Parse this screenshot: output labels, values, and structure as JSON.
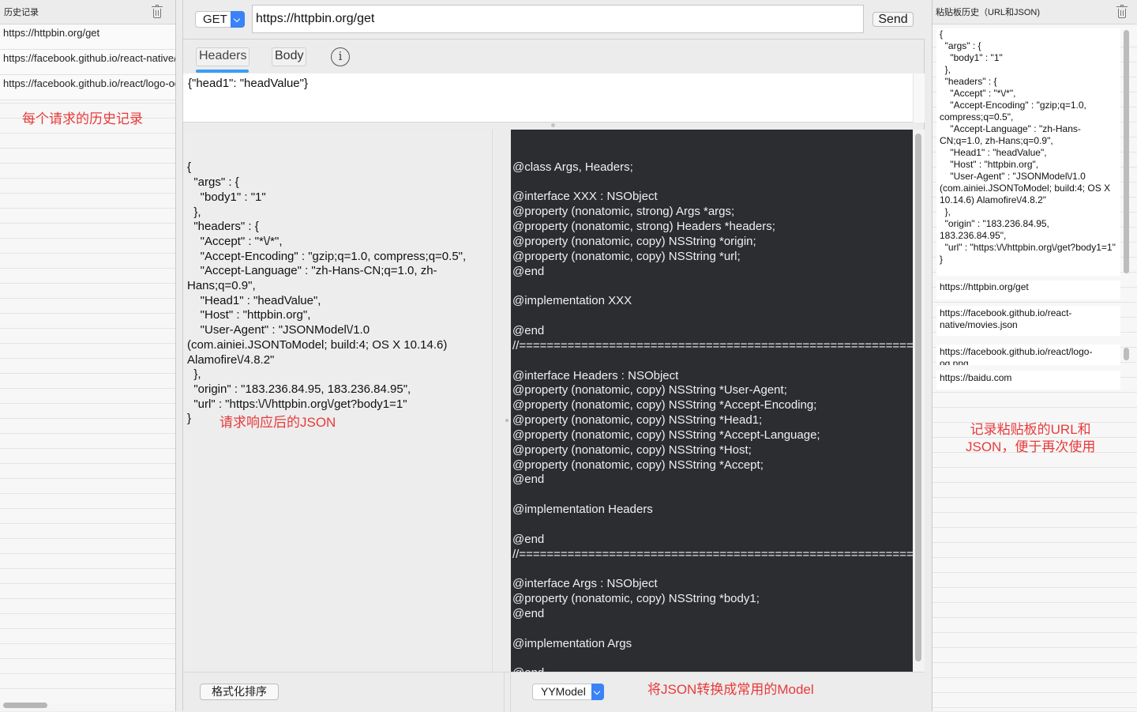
{
  "history": {
    "title": "历史记录",
    "items": [
      "https://httpbin.org/get",
      "https://facebook.github.io/react-native/movies.json",
      "https://facebook.github.io/react/logo-og.png"
    ],
    "annotation": "每个请求的历史记录"
  },
  "request": {
    "method": "GET",
    "url": "https://httpbin.org/get",
    "send_label": "Send",
    "tabs": [
      "Headers",
      "Body"
    ],
    "info_glyph": "i",
    "headers_value": "{\"head1\": \"headValue\"}"
  },
  "response": {
    "json": "{\n  \"args\" : {\n    \"body1\" : \"1\"\n  },\n  \"headers\" : {\n    \"Accept\" : \"*\\/*\",\n    \"Accept-Encoding\" : \"gzip;q=1.0, compress;q=0.5\",\n    \"Accept-Language\" : \"zh-Hans-CN;q=1.0, zh-Hans;q=0.9\",\n    \"Head1\" : \"headValue\",\n    \"Host\" : \"httpbin.org\",\n    \"User-Agent\" : \"JSONModel\\/1.0 (com.ainiei.JSONToModel; build:4; OS X 10.14.6) Alamofire\\/4.8.2\"\n  },\n  \"origin\" : \"183.236.84.95, 183.236.84.95\",\n  \"url\" : \"https:\\/\\/httpbin.org\\/get?body1=1\"\n}",
    "annotation": "请求响应后的JSON",
    "format_button": "格式化排序"
  },
  "model": {
    "code": "@class Args, Headers;\n\n@interface XXX : NSObject\n@property (nonatomic, strong) Args *args;\n@property (nonatomic, strong) Headers *headers;\n@property (nonatomic, copy) NSString *origin;\n@property (nonatomic, copy) NSString *url;\n@end\n\n@implementation XXX\n\n@end\n//=================================================================\n\n@interface Headers : NSObject\n@property (nonatomic, copy) NSString *User-Agent;\n@property (nonatomic, copy) NSString *Accept-Encoding;\n@property (nonatomic, copy) NSString *Head1;\n@property (nonatomic, copy) NSString *Accept-Language;\n@property (nonatomic, copy) NSString *Host;\n@property (nonatomic, copy) NSString *Accept;\n@end\n\n@implementation Headers\n\n@end\n//=================================================================\n\n@interface Args : NSObject\n@property (nonatomic, copy) NSString *body1;\n@end\n\n@implementation Args\n\n@end\n//=================================================================",
    "selected": "YYModel",
    "annotation": "将JSON转换成常用的Model"
  },
  "clipboard": {
    "title": "粘贴板历史（URL和JSON)",
    "json_item": "{\n  \"args\" : {\n    \"body1\" : \"1\"\n  },\n  \"headers\" : {\n    \"Accept\" : \"*\\/*\",\n    \"Accept-Encoding\" : \"gzip;q=1.0, compress;q=0.5\",\n    \"Accept-Language\" : \"zh-Hans-CN;q=1.0, zh-Hans;q=0.9\",\n    \"Head1\" : \"headValue\",\n    \"Host\" : \"httpbin.org\",\n    \"User-Agent\" : \"JSONModel\\/1.0 (com.ainiei.JSONToModel; build:4; OS X 10.14.6) Alamofire\\/4.8.2\"\n  },\n  \"origin\" : \"183.236.84.95, 183.236.84.95\",\n  \"url\" : \"https:\\/\\/httpbin.org\\/get?body1=1\"\n}",
    "items": [
      "https://httpbin.org/get",
      "https://facebook.github.io/react-native/movies.json",
      "https://facebook.github.io/react/logo-og.png",
      "https://baidu.com"
    ],
    "annotation": "记录粘贴板的URL和\nJSON，便于再次使用"
  },
  "colors": {
    "accent": "#3a82f7",
    "annotation": "#e83a3a",
    "code_background": "#2b2d31",
    "tab_underline": "#3a9df5"
  }
}
